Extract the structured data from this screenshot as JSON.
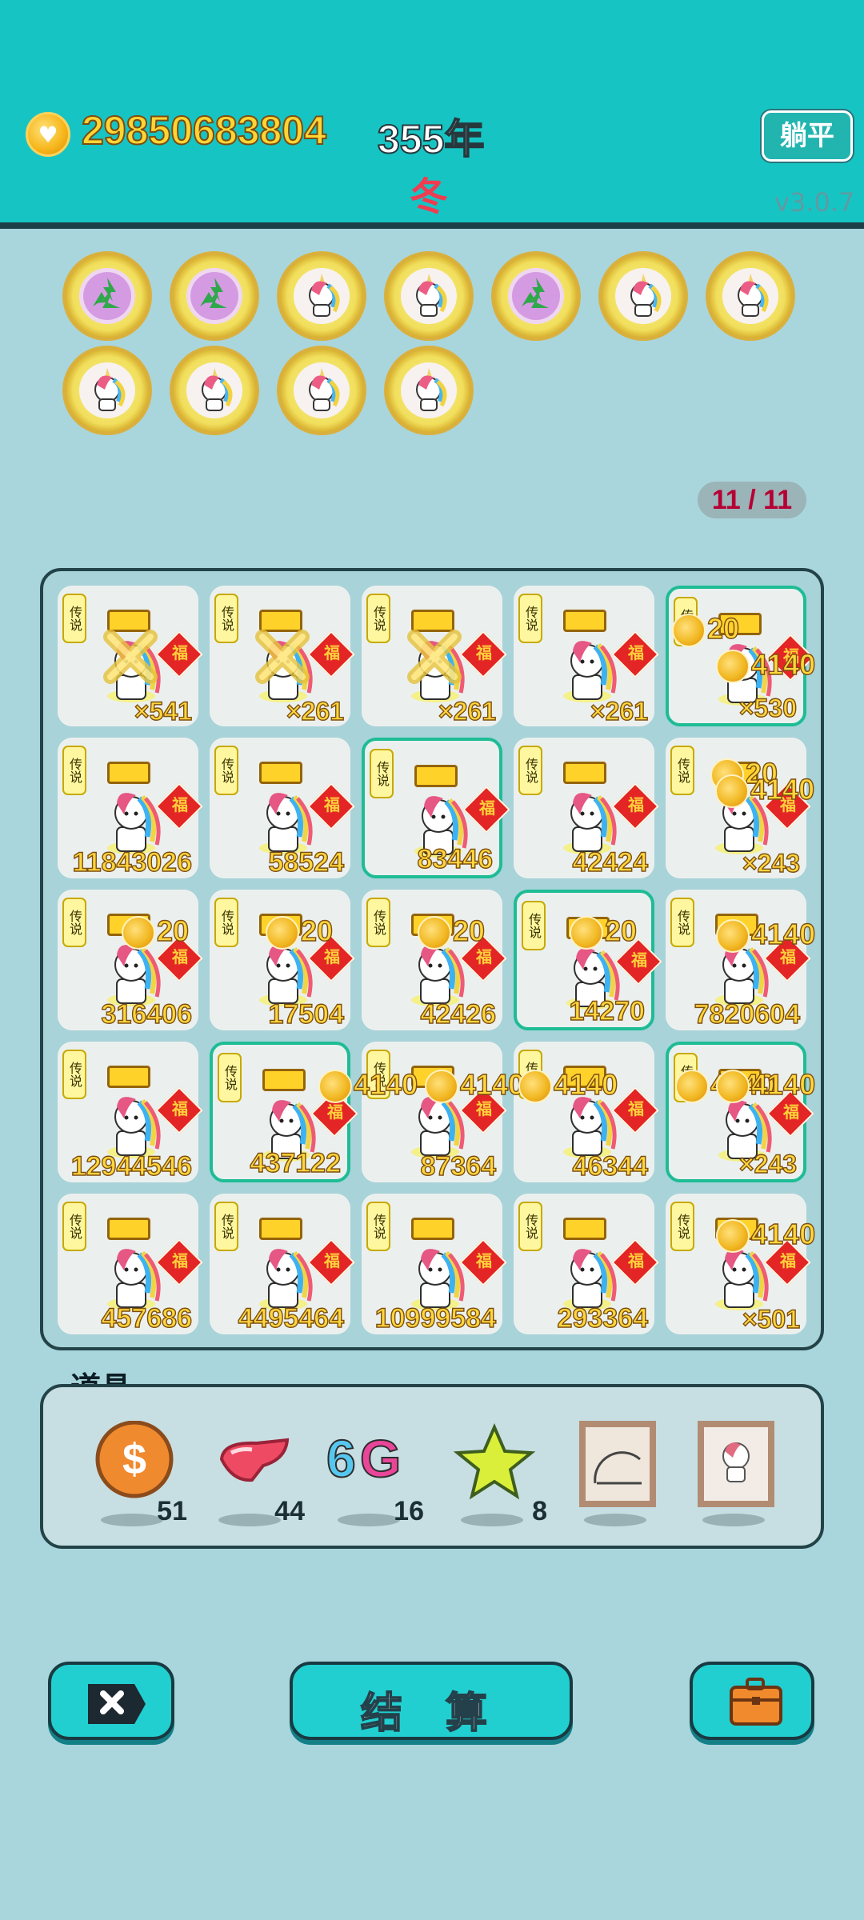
{
  "header": {
    "money": "29850683804",
    "year": "355年",
    "season": "冬",
    "flat_button": "躺平",
    "version": "v3.0.7"
  },
  "tokens": [
    {
      "icon": "recycle-icon"
    },
    {
      "icon": "recycle-icon"
    },
    {
      "icon": "unicorn-icon"
    },
    {
      "icon": "unicorn-icon"
    },
    {
      "icon": "recycle-icon"
    },
    {
      "icon": "unicorn-icon"
    },
    {
      "icon": "unicorn-icon"
    },
    {
      "icon": "unicorn-icon"
    },
    {
      "icon": "unicorn-icon"
    },
    {
      "icon": "unicorn-icon"
    },
    {
      "icon": "unicorn-icon"
    }
  ],
  "progress": "11 / 11",
  "board": {
    "legend_text": "传说",
    "fu_text": "福",
    "rows": [
      [
        {
          "value": "×541",
          "highlight": false,
          "crossed": true
        },
        {
          "value": "×261",
          "highlight": false,
          "crossed": true
        },
        {
          "value": "×261",
          "highlight": false,
          "crossed": true
        },
        {
          "value": "×261",
          "highlight": false
        },
        {
          "value": "×530",
          "highlight": true
        }
      ],
      [
        {
          "value": "11843026",
          "highlight": false
        },
        {
          "value": "58524",
          "highlight": false
        },
        {
          "value": "83446",
          "highlight": true
        },
        {
          "value": "42424",
          "highlight": false
        },
        {
          "value": "×243",
          "highlight": false
        }
      ],
      [
        {
          "value": "316406",
          "highlight": false
        },
        {
          "value": "17504",
          "highlight": false
        },
        {
          "value": "42426",
          "highlight": false
        },
        {
          "value": "14270",
          "highlight": true
        },
        {
          "value": "7820604",
          "highlight": false
        }
      ],
      [
        {
          "value": "12944546",
          "highlight": false
        },
        {
          "value": "437122",
          "highlight": true
        },
        {
          "value": "87364",
          "highlight": false
        },
        {
          "value": "46344",
          "highlight": false
        },
        {
          "value": "×243",
          "highlight": true
        }
      ],
      [
        {
          "value": "457686",
          "highlight": false
        },
        {
          "value": "4495464",
          "highlight": false
        },
        {
          "value": "10999584",
          "highlight": false
        },
        {
          "value": "293364",
          "highlight": false
        },
        {
          "value": "×501",
          "highlight": false
        }
      ]
    ],
    "floating_badges": [
      {
        "text": "20"
      },
      {
        "text": "4140"
      },
      {
        "text": "20"
      },
      {
        "text": "4140"
      },
      {
        "text": "20"
      },
      {
        "text": "20"
      },
      {
        "text": "20"
      },
      {
        "text": "20"
      },
      {
        "text": "4140"
      },
      {
        "text": "4140"
      },
      {
        "text": "4140"
      },
      {
        "text": "4140"
      },
      {
        "text": "4140"
      },
      {
        "text": "4140"
      },
      {
        "text": "4140"
      }
    ]
  },
  "props": {
    "title": "道具",
    "items": [
      {
        "name": "coin-prop",
        "count": "51"
      },
      {
        "name": "liver-prop",
        "count": "44"
      },
      {
        "name": "6g-prop",
        "count": "16",
        "text": "6G"
      },
      {
        "name": "star-prop",
        "count": "8"
      },
      {
        "name": "frame-chart-prop",
        "count": ""
      },
      {
        "name": "frame-unicorn-prop",
        "count": ""
      }
    ]
  },
  "buttons": {
    "settle": "结 算"
  },
  "colors": {
    "header_bg": "#17c4c4",
    "page_bg": "#a9d6dc",
    "gold_text": "#ffd73c",
    "accent_red": "#e32625"
  }
}
